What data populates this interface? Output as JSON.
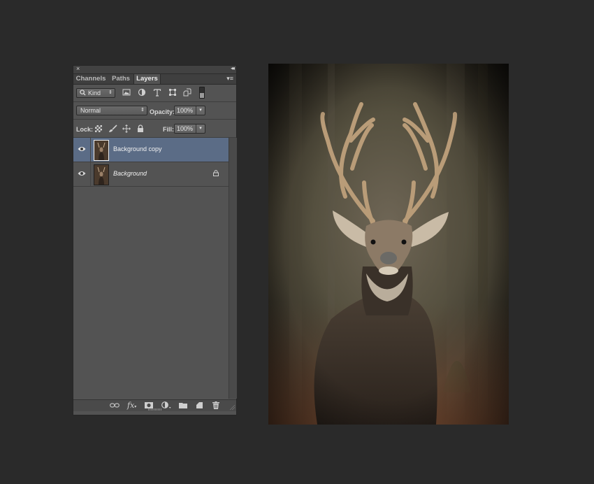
{
  "panel": {
    "close_glyph": "×",
    "collapse_glyph": "◂◂",
    "menu_glyph": "▾≡",
    "tabs": [
      {
        "label": "Channels"
      },
      {
        "label": "Paths"
      },
      {
        "label": "Layers"
      }
    ],
    "filter": {
      "label": "Kind",
      "search_icon": "search-icon"
    },
    "blend_mode": "Normal",
    "opacity_label": "Opacity:",
    "opacity_value": "100%",
    "lock_label": "Lock:",
    "fill_label": "Fill:",
    "fill_value": "100%",
    "layers": [
      {
        "name": "Background copy",
        "selected": true,
        "italic": false,
        "locked": false
      },
      {
        "name": "Background",
        "selected": false,
        "italic": true,
        "locked": true
      }
    ]
  },
  "colors": {
    "background": "#2a2a2a",
    "panel": "#535353",
    "selection": "#5b6c86"
  }
}
